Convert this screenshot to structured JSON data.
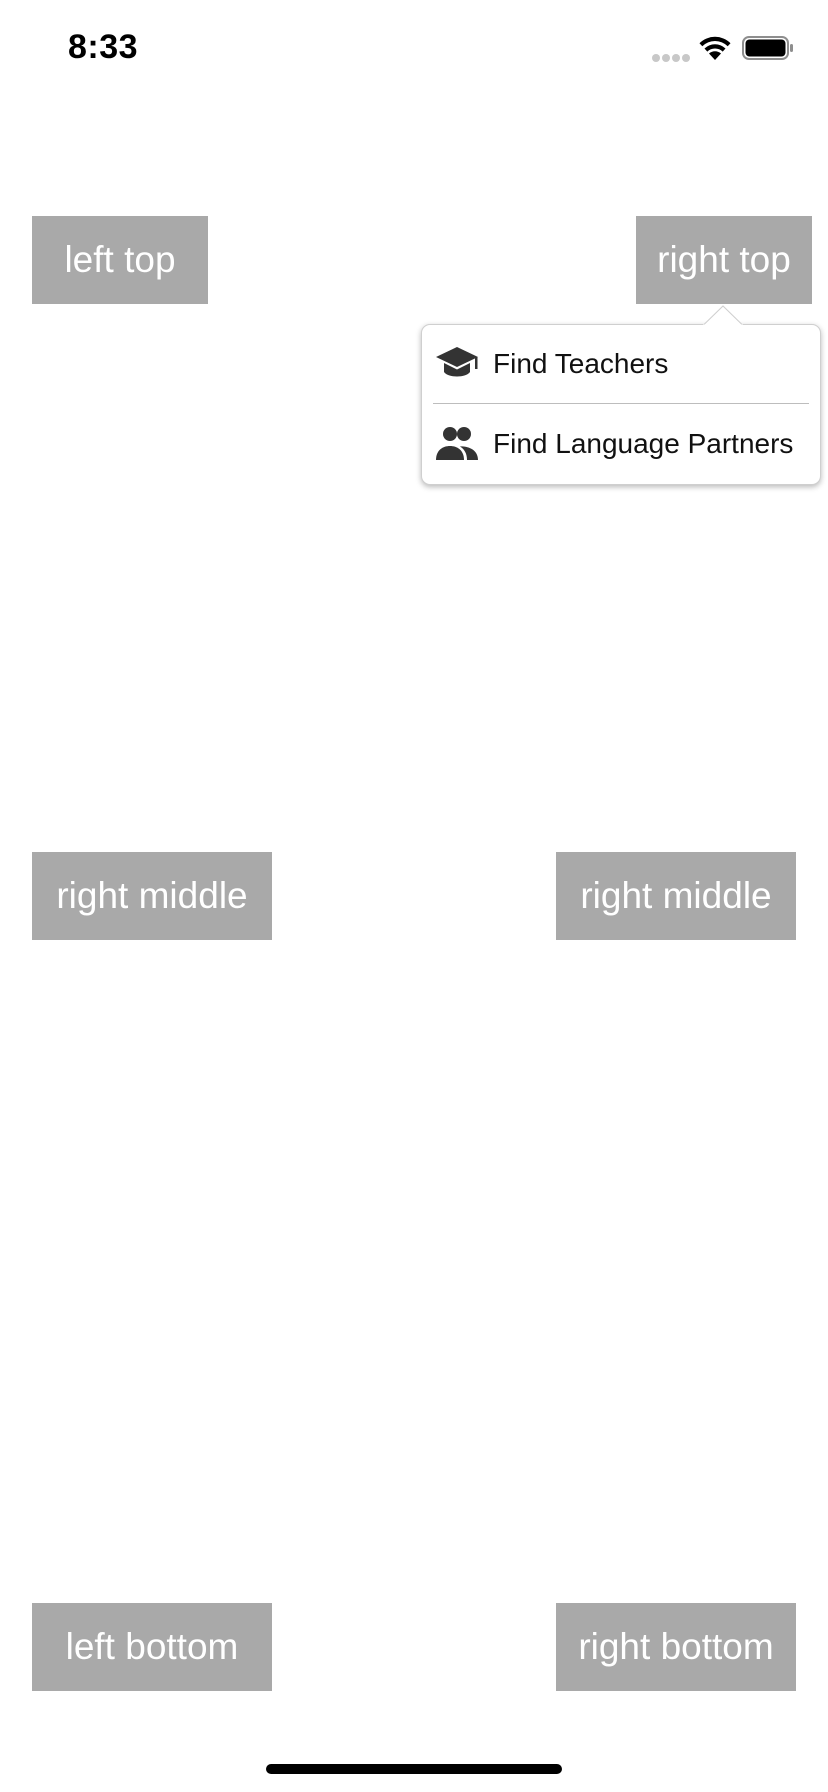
{
  "status_bar": {
    "time": "8:33"
  },
  "buttons": {
    "left_top": "left top",
    "right_top": "right top",
    "left_middle": "right middle",
    "right_middle": "right middle",
    "left_bottom": "left bottom",
    "right_bottom": "right bottom"
  },
  "popover": {
    "items": [
      {
        "label": "Find Teachers",
        "icon": "graduation-cap-icon"
      },
      {
        "label": "Find Language Partners",
        "icon": "people-icon"
      }
    ]
  },
  "colors": {
    "button_bg": "#a9a9a9",
    "button_text": "#ffffff",
    "icon_color": "#333333"
  }
}
